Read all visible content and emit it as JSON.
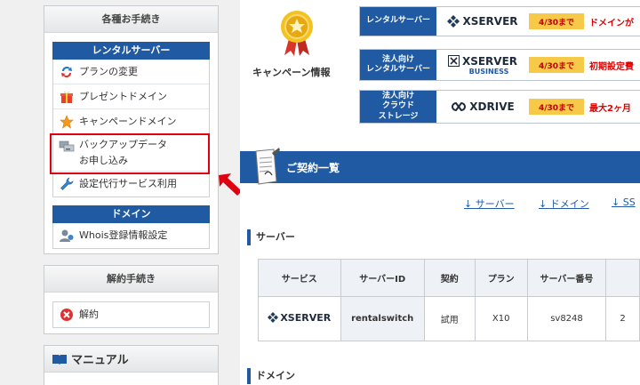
{
  "sidebar": {
    "procedures": {
      "title": "各種お手続き",
      "rental_section": "レンタルサーバー",
      "rental_items": [
        {
          "label": "プランの変更",
          "icon": "refresh-arrows-icon"
        },
        {
          "label": "プレゼントドメイン",
          "icon": "gift-icon"
        },
        {
          "label": "キャンペーンドメイン",
          "icon": "star-icon"
        },
        {
          "label_line1": "バックアップデータ",
          "label_line2": "お申し込み",
          "icon": "backup-drive-icon"
        },
        {
          "label": "設定代行サービス利用",
          "icon": "wrench-icon"
        }
      ],
      "domain_section": "ドメイン",
      "domain_items": [
        {
          "label": "Whois登録情報設定",
          "icon": "user-icon"
        }
      ]
    },
    "cancellation": {
      "title": "解約手続き",
      "items": [
        {
          "label": "解約",
          "icon": "cancel-icon"
        }
      ]
    },
    "manual": {
      "title": "マニュアル",
      "icon": "book-icon"
    }
  },
  "campaign": {
    "label": "キャンペーン情報",
    "rows": [
      {
        "category": "レンタルサーバー",
        "brand": "XSERVER",
        "brand_sub": "",
        "date": "4/30まで",
        "offer": "ドメインが"
      },
      {
        "category_line1": "法人向け",
        "category_line2": "レンタルサーバー",
        "brand": "XSERVER",
        "brand_sub": "BUSINESS",
        "date": "4/30まで",
        "offer": "初期設定費"
      },
      {
        "category_line1": "法人向け",
        "category_line2": "クラウド",
        "category_line3": "ストレージ",
        "brand": "XDRIVE",
        "brand_sub": "",
        "date": "4/30まで",
        "offer": "最大2ヶ月"
      }
    ]
  },
  "contracts": {
    "title": "ご契約一覧",
    "anchors": [
      "サーバー",
      "ドメイン",
      "SS"
    ],
    "server_section": "サーバー",
    "server_table": {
      "headers": [
        "サービス",
        "サーバーID",
        "契約",
        "プラン",
        "サーバー番号"
      ],
      "rows": [
        {
          "service": "XSERVER",
          "server_id": "rentalswitch",
          "contract": "試用",
          "plan": "X10",
          "server_no": "sv8248",
          "extra": "2"
        }
      ]
    },
    "domain_section": "ドメイン"
  },
  "colors": {
    "accent": "#1f5aa3",
    "highlight": "#e00010",
    "date_badge": "#f7c948"
  }
}
